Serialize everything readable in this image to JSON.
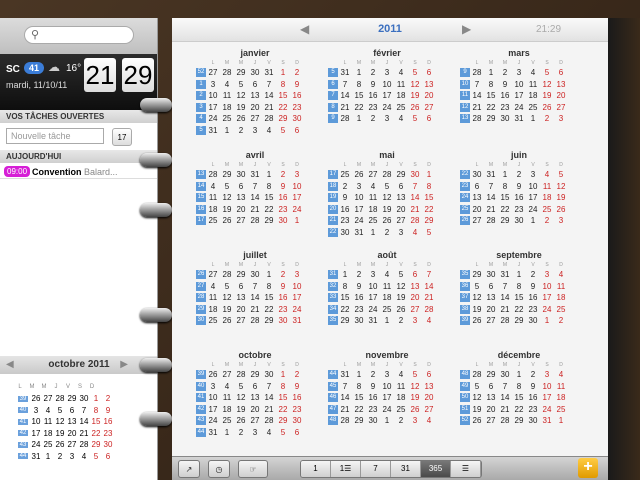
{
  "search": {
    "placeholder": ""
  },
  "weather": {
    "city": "SC",
    "badge": "41",
    "temp": "16°",
    "date": "mardi, 11/10/11",
    "hour": "21",
    "minute": "29"
  },
  "tasks": {
    "header": "VOS TÂCHES OUVERTES",
    "placeholder": "Nouvelle tâche",
    "cal_day": "17"
  },
  "today": {
    "header": "AUJOURD'HUI",
    "event_time": "09:00",
    "event_title": "Convention",
    "event_location": "Balard..."
  },
  "mini": {
    "title": "octobre 2011",
    "dow": [
      "L",
      "M",
      "M",
      "J",
      "V",
      "S",
      "D"
    ],
    "rows": [
      {
        "wk": "39",
        "days": [
          "26",
          "27",
          "28",
          "29",
          "30",
          "1",
          "2"
        ]
      },
      {
        "wk": "40",
        "days": [
          "3",
          "4",
          "5",
          "6",
          "7",
          "8",
          "9"
        ]
      },
      {
        "wk": "41",
        "days": [
          "10",
          "11",
          "12",
          "13",
          "14",
          "15",
          "16"
        ]
      },
      {
        "wk": "42",
        "days": [
          "17",
          "18",
          "19",
          "20",
          "21",
          "22",
          "23"
        ]
      },
      {
        "wk": "43",
        "days": [
          "24",
          "25",
          "26",
          "27",
          "28",
          "29",
          "30"
        ]
      },
      {
        "wk": "44",
        "days": [
          "31",
          "1",
          "2",
          "3",
          "4",
          "5",
          "6"
        ]
      }
    ]
  },
  "year": {
    "label": "2011",
    "clock": "21:29"
  },
  "dow": [
    "L",
    "M",
    "M",
    "J",
    "V",
    "S",
    "D"
  ],
  "months": [
    {
      "name": "janvier",
      "rows": [
        [
          "52",
          "27",
          "28",
          "29",
          "30",
          "31",
          "1",
          "2"
        ],
        [
          "1",
          "3",
          "4",
          "5",
          "6",
          "7",
          "8",
          "9"
        ],
        [
          "2",
          "10",
          "11",
          "12",
          "13",
          "14",
          "15",
          "16"
        ],
        [
          "3",
          "17",
          "18",
          "19",
          "20",
          "21",
          "22",
          "23"
        ],
        [
          "4",
          "24",
          "25",
          "26",
          "27",
          "28",
          "29",
          "30"
        ],
        [
          "5",
          "31",
          "1",
          "2",
          "3",
          "4",
          "5",
          "6"
        ]
      ]
    },
    {
      "name": "février",
      "rows": [
        [
          "5",
          "31",
          "1",
          "2",
          "3",
          "4",
          "5",
          "6"
        ],
        [
          "6",
          "7",
          "8",
          "9",
          "10",
          "11",
          "12",
          "13"
        ],
        [
          "7",
          "14",
          "15",
          "16",
          "17",
          "18",
          "19",
          "20"
        ],
        [
          "8",
          "21",
          "22",
          "23",
          "24",
          "25",
          "26",
          "27"
        ],
        [
          "9",
          "28",
          "1",
          "2",
          "3",
          "4",
          "5",
          "6"
        ]
      ]
    },
    {
      "name": "mars",
      "rows": [
        [
          "9",
          "28",
          "1",
          "2",
          "3",
          "4",
          "5",
          "6"
        ],
        [
          "10",
          "7",
          "8",
          "9",
          "10",
          "11",
          "12",
          "13"
        ],
        [
          "11",
          "14",
          "15",
          "16",
          "17",
          "18",
          "19",
          "20"
        ],
        [
          "12",
          "21",
          "22",
          "23",
          "24",
          "25",
          "26",
          "27"
        ],
        [
          "13",
          "28",
          "29",
          "30",
          "31",
          "1",
          "2",
          "3"
        ]
      ]
    },
    {
      "name": "avril",
      "rows": [
        [
          "13",
          "28",
          "29",
          "30",
          "31",
          "1",
          "2",
          "3"
        ],
        [
          "14",
          "4",
          "5",
          "6",
          "7",
          "8",
          "9",
          "10"
        ],
        [
          "15",
          "11",
          "12",
          "13",
          "14",
          "15",
          "16",
          "17"
        ],
        [
          "16",
          "18",
          "19",
          "20",
          "21",
          "22",
          "23",
          "24"
        ],
        [
          "17",
          "25",
          "26",
          "27",
          "28",
          "29",
          "30",
          "1"
        ]
      ]
    },
    {
      "name": "mai",
      "rows": [
        [
          "17",
          "25",
          "26",
          "27",
          "28",
          "29",
          "30",
          "1"
        ],
        [
          "18",
          "2",
          "3",
          "4",
          "5",
          "6",
          "7",
          "8"
        ],
        [
          "19",
          "9",
          "10",
          "11",
          "12",
          "13",
          "14",
          "15"
        ],
        [
          "20",
          "16",
          "17",
          "18",
          "19",
          "20",
          "21",
          "22"
        ],
        [
          "21",
          "23",
          "24",
          "25",
          "26",
          "27",
          "28",
          "29"
        ],
        [
          "22",
          "30",
          "31",
          "1",
          "2",
          "3",
          "4",
          "5"
        ]
      ]
    },
    {
      "name": "juin",
      "rows": [
        [
          "22",
          "30",
          "31",
          "1",
          "2",
          "3",
          "4",
          "5"
        ],
        [
          "23",
          "6",
          "7",
          "8",
          "9",
          "10",
          "11",
          "12"
        ],
        [
          "24",
          "13",
          "14",
          "15",
          "16",
          "17",
          "18",
          "19"
        ],
        [
          "25",
          "20",
          "21",
          "22",
          "23",
          "24",
          "25",
          "26"
        ],
        [
          "26",
          "27",
          "28",
          "29",
          "30",
          "1",
          "2",
          "3"
        ]
      ]
    },
    {
      "name": "juillet",
      "rows": [
        [
          "26",
          "27",
          "28",
          "29",
          "30",
          "1",
          "2",
          "3"
        ],
        [
          "27",
          "4",
          "5",
          "6",
          "7",
          "8",
          "9",
          "10"
        ],
        [
          "28",
          "11",
          "12",
          "13",
          "14",
          "15",
          "16",
          "17"
        ],
        [
          "29",
          "18",
          "19",
          "20",
          "21",
          "22",
          "23",
          "24"
        ],
        [
          "30",
          "25",
          "26",
          "27",
          "28",
          "29",
          "30",
          "31"
        ]
      ]
    },
    {
      "name": "août",
      "rows": [
        [
          "31",
          "1",
          "2",
          "3",
          "4",
          "5",
          "6",
          "7"
        ],
        [
          "32",
          "8",
          "9",
          "10",
          "11",
          "12",
          "13",
          "14"
        ],
        [
          "33",
          "15",
          "16",
          "17",
          "18",
          "19",
          "20",
          "21"
        ],
        [
          "34",
          "22",
          "23",
          "24",
          "25",
          "26",
          "27",
          "28"
        ],
        [
          "35",
          "29",
          "30",
          "31",
          "1",
          "2",
          "3",
          "4"
        ]
      ]
    },
    {
      "name": "septembre",
      "rows": [
        [
          "35",
          "29",
          "30",
          "31",
          "1",
          "2",
          "3",
          "4"
        ],
        [
          "36",
          "5",
          "6",
          "7",
          "8",
          "9",
          "10",
          "11"
        ],
        [
          "37",
          "12",
          "13",
          "14",
          "15",
          "16",
          "17",
          "18"
        ],
        [
          "38",
          "19",
          "20",
          "21",
          "22",
          "23",
          "24",
          "25"
        ],
        [
          "39",
          "26",
          "27",
          "28",
          "29",
          "30",
          "1",
          "2"
        ]
      ]
    },
    {
      "name": "octobre",
      "rows": [
        [
          "39",
          "26",
          "27",
          "28",
          "29",
          "30",
          "1",
          "2"
        ],
        [
          "40",
          "3",
          "4",
          "5",
          "6",
          "7",
          "8",
          "9"
        ],
        [
          "41",
          "10",
          "11",
          "12",
          "13",
          "14",
          "15",
          "16"
        ],
        [
          "42",
          "17",
          "18",
          "19",
          "20",
          "21",
          "22",
          "23"
        ],
        [
          "43",
          "24",
          "25",
          "26",
          "27",
          "28",
          "29",
          "30"
        ],
        [
          "44",
          "31",
          "1",
          "2",
          "3",
          "4",
          "5",
          "6"
        ]
      ]
    },
    {
      "name": "novembre",
      "rows": [
        [
          "44",
          "31",
          "1",
          "2",
          "3",
          "4",
          "5",
          "6"
        ],
        [
          "45",
          "7",
          "8",
          "9",
          "10",
          "11",
          "12",
          "13"
        ],
        [
          "46",
          "14",
          "15",
          "16",
          "17",
          "18",
          "19",
          "20"
        ],
        [
          "47",
          "21",
          "22",
          "23",
          "24",
          "25",
          "26",
          "27"
        ],
        [
          "48",
          "28",
          "29",
          "30",
          "1",
          "2",
          "3",
          "4"
        ]
      ]
    },
    {
      "name": "décembre",
      "rows": [
        [
          "48",
          "28",
          "29",
          "30",
          "1",
          "2",
          "3",
          "4"
        ],
        [
          "49",
          "5",
          "6",
          "7",
          "8",
          "9",
          "10",
          "11"
        ],
        [
          "50",
          "12",
          "13",
          "14",
          "15",
          "16",
          "17",
          "18"
        ],
        [
          "51",
          "19",
          "20",
          "21",
          "22",
          "23",
          "24",
          "25"
        ],
        [
          "52",
          "26",
          "27",
          "28",
          "29",
          "30",
          "31",
          "1"
        ]
      ]
    }
  ],
  "toolbar": {
    "views": [
      "1",
      "1☰",
      "7",
      "31",
      "365",
      "☰"
    ],
    "selected": "365",
    "add": "+"
  }
}
